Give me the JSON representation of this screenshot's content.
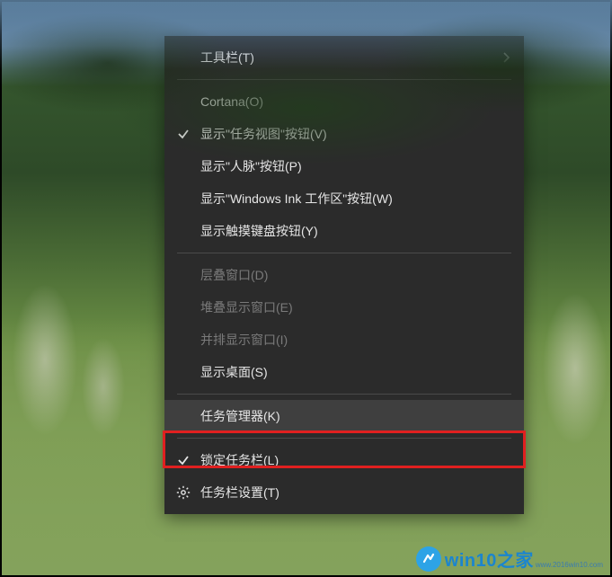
{
  "menu": {
    "items": [
      {
        "label": "工具栏(T)",
        "submenu": true
      },
      null,
      {
        "label": "Cortana(O)"
      },
      {
        "label": "显示\"任务视图\"按钮(V)",
        "checked": true
      },
      {
        "label": "显示\"人脉\"按钮(P)"
      },
      {
        "label": "显示\"Windows Ink 工作区\"按钮(W)"
      },
      {
        "label": "显示触摸键盘按钮(Y)"
      },
      null,
      {
        "label": "层叠窗口(D)",
        "disabled": true
      },
      {
        "label": "堆叠显示窗口(E)",
        "disabled": true
      },
      {
        "label": "并排显示窗口(I)",
        "disabled": true
      },
      {
        "label": "显示桌面(S)"
      },
      null,
      {
        "label": "任务管理器(K)",
        "highlight": true
      },
      null,
      {
        "label": "锁定任务栏(L)",
        "checked": true
      },
      {
        "label": "任务栏设置(T)",
        "gear": true
      }
    ]
  },
  "watermark": {
    "brand": "win10之家",
    "url": "www.2016win10.com"
  }
}
